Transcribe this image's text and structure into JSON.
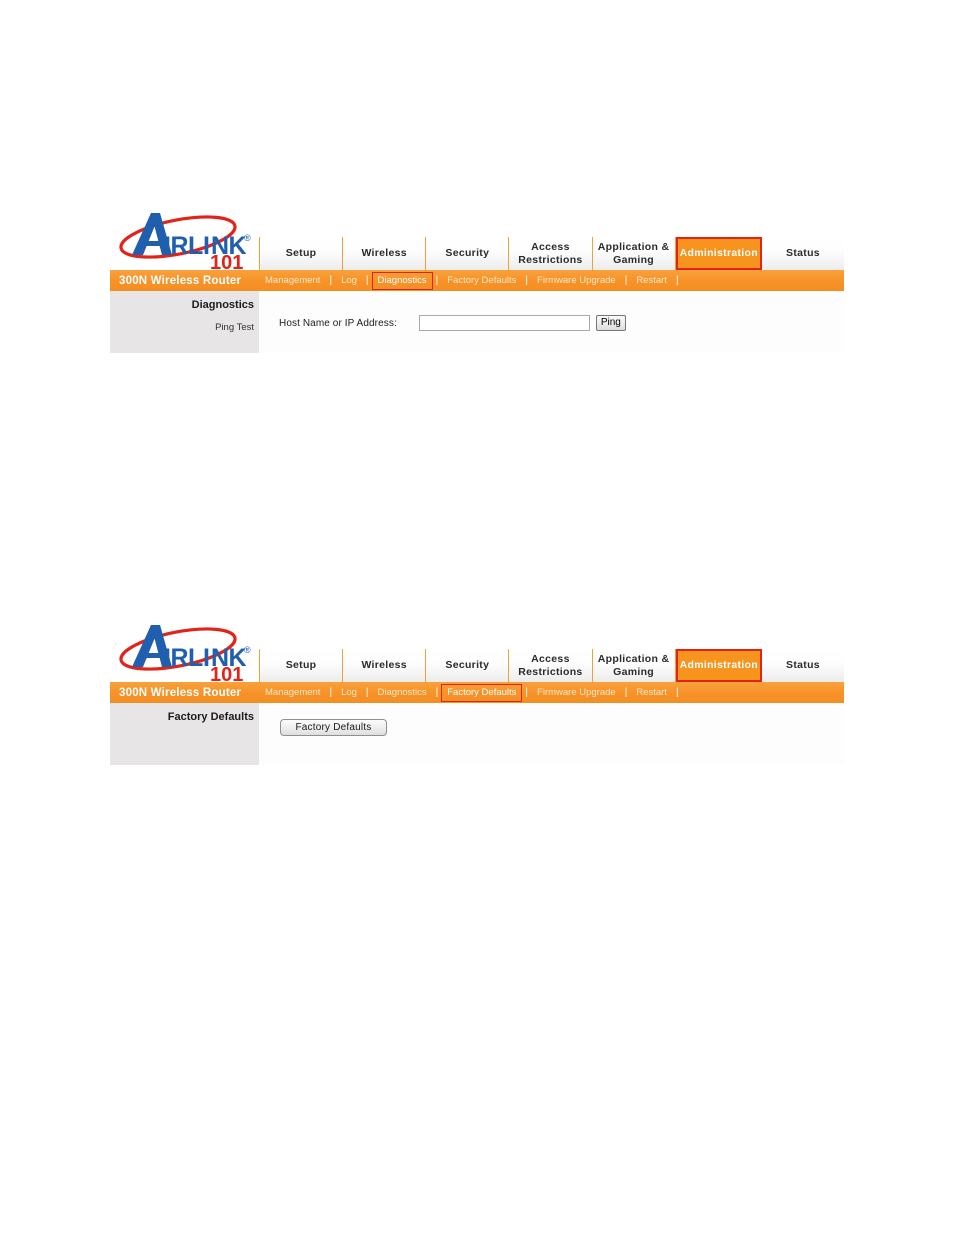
{
  "page": {
    "background": "#ffffff",
    "accent_orange": "#f7941e",
    "highlight_red": "#e2231a",
    "sidebar_gray": "#e7e5e5"
  },
  "brand": {
    "name": "AIRLINK",
    "name_lead": "A",
    "name_rest": "IRLINK",
    "registered_mark": "®",
    "sub": "101",
    "blue": "#1f5fae",
    "red": "#e2231a"
  },
  "tabs": [
    {
      "label": "Setup",
      "active": false
    },
    {
      "label": "Wireless",
      "active": false
    },
    {
      "label": "Security",
      "active": false
    },
    {
      "label": "Access\nRestrictions",
      "active": false
    },
    {
      "label": "Application &\nGaming",
      "active": false
    },
    {
      "label": "Administration",
      "active": true
    },
    {
      "label": "Status",
      "active": false
    }
  ],
  "model_name": "300N Wireless Router",
  "subnav_separator": "|",
  "panels": [
    {
      "id": "diagnostics",
      "subnav": [
        {
          "label": "Management",
          "highlighted": false
        },
        {
          "label": "Log",
          "highlighted": false
        },
        {
          "label": "Diagnostics",
          "highlighted": true
        },
        {
          "label": "Factory Defaults",
          "highlighted": false
        },
        {
          "label": "Firmware Upgrade",
          "highlighted": false
        },
        {
          "label": "Restart",
          "highlighted": false
        }
      ],
      "sidebar_title": "Diagnostics",
      "sidebar_sub": "Ping Test",
      "field_label": "Host Name or IP Address:",
      "field_value": "",
      "field_placeholder": "",
      "button_label": "Ping"
    },
    {
      "id": "factory-defaults",
      "subnav": [
        {
          "label": "Management",
          "highlighted": false
        },
        {
          "label": "Log",
          "highlighted": false
        },
        {
          "label": "Diagnostics",
          "highlighted": false
        },
        {
          "label": "Factory Defaults",
          "highlighted": true
        },
        {
          "label": "Firmware Upgrade",
          "highlighted": false
        },
        {
          "label": "Restart",
          "highlighted": false
        }
      ],
      "sidebar_title": "Factory Defaults",
      "sidebar_sub": "",
      "button_label": "Factory Defaults"
    }
  ]
}
